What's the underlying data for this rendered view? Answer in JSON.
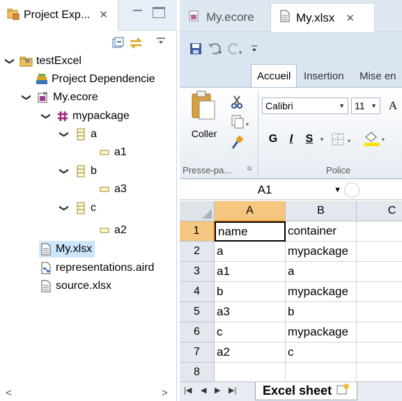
{
  "explorer": {
    "title": "Project Exp...",
    "close": "✕",
    "tree": [
      {
        "label": "testExcel",
        "icon": "project-folder-icon",
        "twisty": "expanded"
      },
      {
        "label": "Project Dependencie",
        "icon": "dependencies-icon",
        "twisty": "none"
      },
      {
        "label": "My.ecore",
        "icon": "ecore-file-icon",
        "twisty": "expanded"
      },
      {
        "label": "mypackage",
        "icon": "package-icon",
        "twisty": "expanded"
      },
      {
        "label": "a",
        "icon": "class-icon",
        "twisty": "expanded"
      },
      {
        "label": "a1",
        "icon": "attribute-icon",
        "twisty": "none"
      },
      {
        "label": "b",
        "icon": "class-icon",
        "twisty": "expanded"
      },
      {
        "label": "a3",
        "icon": "attribute-icon",
        "twisty": "none"
      },
      {
        "label": "c",
        "icon": "class-icon",
        "twisty": "expanded"
      },
      {
        "label": "a2",
        "icon": "attribute-icon",
        "twisty": "none"
      },
      {
        "label": "My.xlsx",
        "icon": "xlsx-file-icon",
        "twisty": "none",
        "selected": true
      },
      {
        "label": "representations.aird",
        "icon": "aird-file-icon",
        "twisty": "none"
      },
      {
        "label": "source.xlsx",
        "icon": "xlsx-file-icon",
        "twisty": "none"
      }
    ]
  },
  "editor": {
    "tabs": [
      {
        "label": "My.ecore",
        "active": false
      },
      {
        "label": "My.xlsx",
        "active": true,
        "close": "✕"
      }
    ],
    "ribbon_tabs": [
      "Accueil",
      "Insertion",
      "Mise en"
    ],
    "clipboard": {
      "paste": "Coller",
      "group": "Presse-pa..."
    },
    "font": {
      "name": "Calibri",
      "size": "11",
      "bold": "G",
      "italic": "I",
      "underline": "S",
      "group": "Police"
    },
    "name_box": "A1",
    "columns": [
      "A",
      "B",
      "C"
    ],
    "rows": [
      {
        "num": "1",
        "A": "name",
        "B": "container",
        "C": ""
      },
      {
        "num": "2",
        "A": "a",
        "B": "mypackage",
        "C": ""
      },
      {
        "num": "3",
        "A": "a1",
        "B": "a",
        "C": ""
      },
      {
        "num": "4",
        "A": "b",
        "B": "mypackage",
        "C": ""
      },
      {
        "num": "5",
        "A": "a3",
        "B": "b",
        "C": ""
      },
      {
        "num": "6",
        "A": "c",
        "B": "mypackage",
        "C": ""
      },
      {
        "num": "7",
        "A": "a2",
        "B": "c",
        "C": ""
      },
      {
        "num": "8",
        "A": "",
        "B": "",
        "C": ""
      }
    ],
    "sheet_tab": "Excel sheet"
  },
  "colors": {
    "accent": "#f2a33a",
    "selection": "#cde6fa",
    "chrome": "#dbe5f1"
  }
}
